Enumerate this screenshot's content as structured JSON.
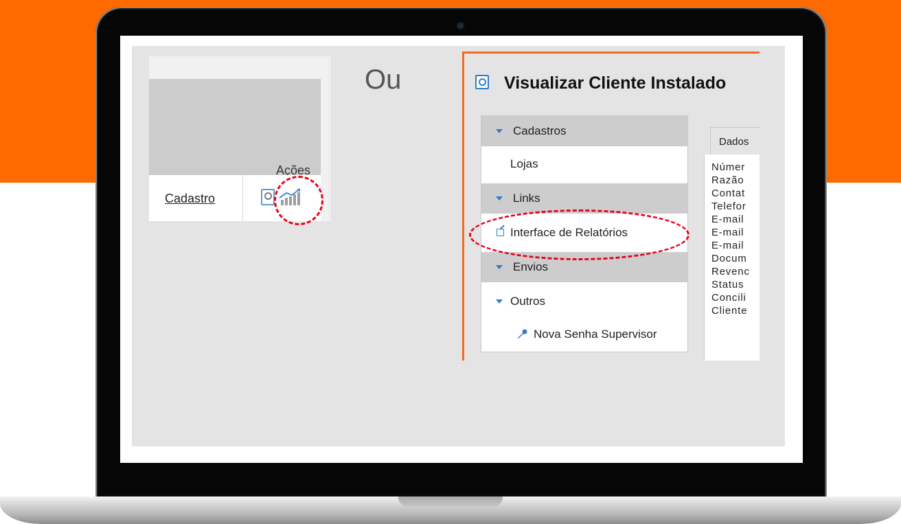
{
  "left_table": {
    "header": "Ações",
    "row": {
      "link": "Cadastro",
      "view_icon": "magnifier-icon",
      "chart_icon": "chart-icon"
    }
  },
  "separator_text": "Ou",
  "client_panel": {
    "title": "Visualizar Cliente Instalado",
    "title_icon": "magnifier-icon",
    "accent_color": "#f26a21",
    "icon_color": "#2f7cc7",
    "sections": {
      "cadastros": {
        "label": "Cadastros",
        "items": [
          "Lojas"
        ]
      },
      "links": {
        "label": "Links",
        "items": [
          "Interface de Relatórios"
        ]
      },
      "envios": {
        "label": "Envios"
      },
      "outros": {
        "label": "Outros",
        "items": [
          "Nova Senha Supervisor"
        ]
      }
    },
    "dados": {
      "tab_label": "Dados",
      "fields": [
        "Númer",
        "Razão",
        "Contat",
        "Telefor",
        "E-mail",
        "E-mail",
        "E-mail",
        "Docum",
        "Revenc",
        "Status",
        "Concili",
        "Cliente"
      ]
    }
  },
  "annotation_color": "#e8001c",
  "background_accent": "#ff6a00"
}
